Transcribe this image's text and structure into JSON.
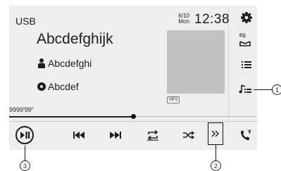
{
  "header": {
    "source": "USB",
    "date_top": "6/10",
    "date_bottom": "Mon",
    "time": "12:38"
  },
  "track": {
    "title": "Abcdefghijk",
    "artist": "Abcdefghi",
    "album": "Abcdef",
    "format": "MP3",
    "elapsed": "9999'99\"",
    "progress": 0.5
  },
  "icons": {
    "settings": "gear-icon",
    "eq": "eq-icon",
    "list": "list-icon",
    "music_browse": "music-browse-icon",
    "play_pause": "play-pause-icon",
    "previous": "previous-track-icon",
    "next": "next-track-icon",
    "repeat": "repeat-icon",
    "shuffle": "shuffle-icon",
    "more": "more-icon",
    "phone": "phone-icon"
  },
  "labels": {
    "eq": "EQ"
  },
  "callouts": {
    "c1": "1",
    "c2": "2",
    "c3": "3"
  }
}
